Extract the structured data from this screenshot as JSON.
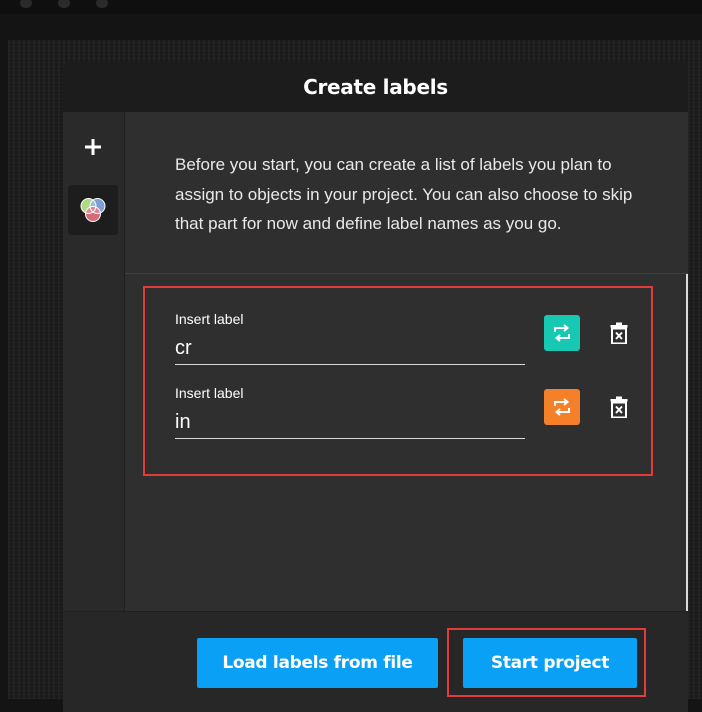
{
  "modal": {
    "title": "Create labels",
    "intro": "Before you start, you can create a list of labels you plan to assign to objects in your project. You can also choose to skip that part for now and define label names as you go."
  },
  "sidebar": {
    "add_icon": "plus-icon",
    "palette_icon": "color-circles-icon"
  },
  "labels": [
    {
      "caption": "Insert label",
      "value": "cr",
      "color": "#17c9b2",
      "color_icon": "swap-icon",
      "delete_icon": "delete-icon"
    },
    {
      "caption": "Insert label",
      "value": "in",
      "color": "#f5802a",
      "color_icon": "swap-icon",
      "delete_icon": "delete-icon"
    }
  ],
  "footer": {
    "load_label": "Load labels from file",
    "start_label": "Start project",
    "button_color": "#0aa0f5"
  }
}
